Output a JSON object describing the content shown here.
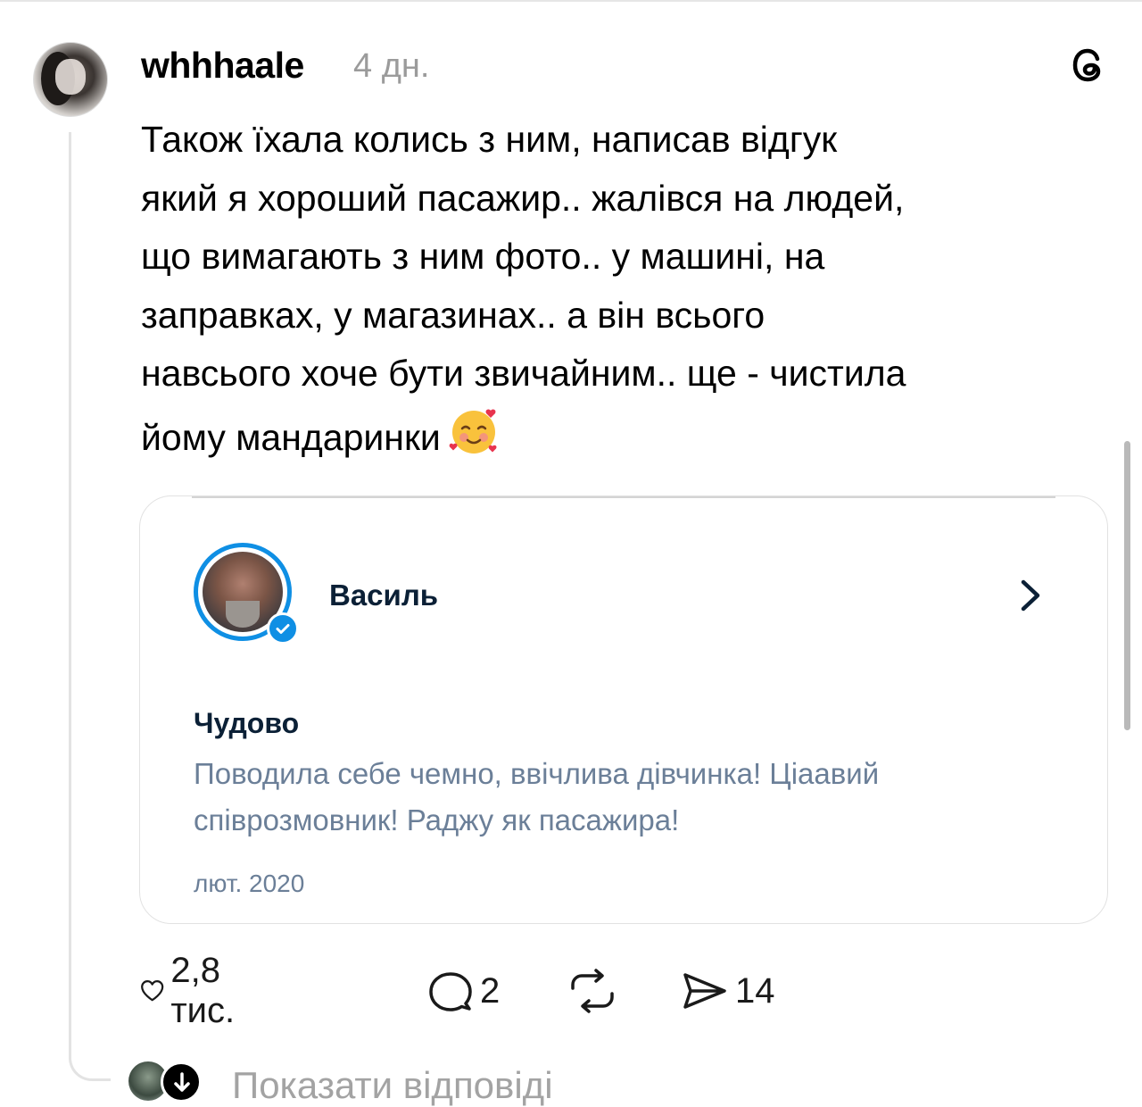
{
  "post": {
    "username": "whhhaale",
    "timestamp": "4 дн.",
    "text": "Також їхала колись з ним, написав відгук\nякий я хороший пасажир.. жалівся на людей,\nщо вимагають з ним фото.. у машині, на\nзаправках, у магазинах.. а він всього\nнавсього хоче бути звичайним.. ще - чистила\nйому мандаринки",
    "emoji": "smiling-face-with-hearts"
  },
  "card": {
    "driver_name": "Василь",
    "rating_title": "Чудово",
    "review_text": "Поводила себе чемно, ввічлива дівчинка! Ціаавий співрозмовник! Раджу як пасажира!",
    "review_date": "лют. 2020"
  },
  "actions": {
    "likes": "2,8 тис.",
    "comments": "2",
    "shares": "14"
  },
  "replies": {
    "label": "Показати відповіді"
  },
  "colors": {
    "accent_blue": "#0f8fe4",
    "review_text": "#6b7f98",
    "muted": "#9b9b9b"
  }
}
